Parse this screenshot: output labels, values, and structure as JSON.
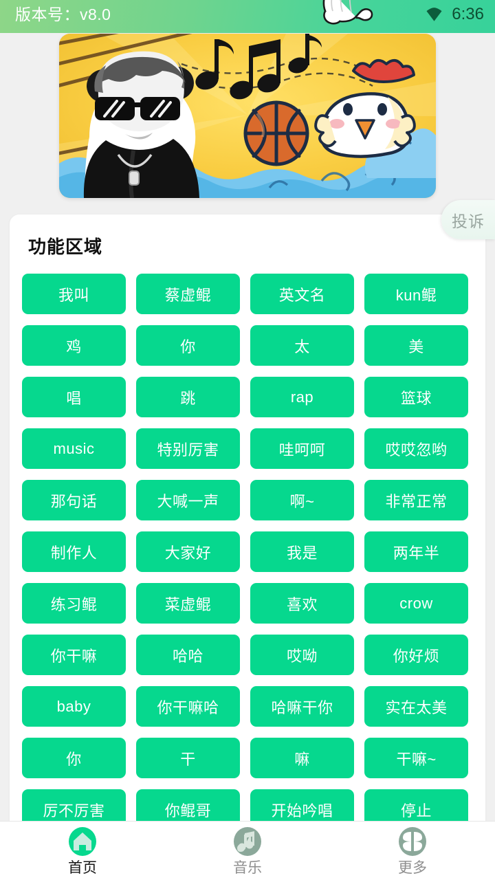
{
  "status_bar": {
    "version_label": "版本号：v8.0",
    "clock": "6:36",
    "wifi_icon": "wifi-icon",
    "glove_icon": "cartoon-glove-icon"
  },
  "banner": {
    "alt": "卡通横幅：戴墨镜的熊猫人、篮球、音符与小鸡",
    "elements": [
      "panda-man-sunglasses",
      "music-notes",
      "basketball",
      "cartoon-chicken",
      "blue-waves"
    ]
  },
  "complaint_button": {
    "label": "投诉"
  },
  "card": {
    "title": "功能区域",
    "buttons": [
      "我叫",
      "蔡虚鲲",
      "英文名",
      "kun鲲",
      "鸡",
      "你",
      "太",
      "美",
      "唱",
      "跳",
      "rap",
      "篮球",
      "music",
      "特别厉害",
      "哇呵呵",
      "哎哎忽哟",
      "那句话",
      "大喊一声",
      "啊~",
      "非常正常",
      "制作人",
      "大家好",
      "我是",
      "两年半",
      "练习鲲",
      "菜虚鲲",
      "喜欢",
      "crow",
      "你干嘛",
      "哈哈",
      "哎呦",
      "你好烦",
      "baby",
      "你干嘛哈",
      "哈嘛干你",
      "实在太美",
      "你",
      "干",
      "嘛",
      "干嘛~",
      "厉不厉害",
      "你鲲哥",
      "开始吟唱",
      "停止"
    ]
  },
  "bottom_nav": {
    "items": [
      {
        "label": "首页",
        "icon": "home-icon",
        "active": true
      },
      {
        "label": "音乐",
        "icon": "music-note-icon",
        "active": false
      },
      {
        "label": "更多",
        "icon": "grid-more-icon",
        "active": false
      }
    ]
  },
  "colors": {
    "accent_green": "#06d88e",
    "header_gradient_start": "#8ed688",
    "header_gradient_end": "#37d29a",
    "page_background": "#f0f0f0",
    "card_background": "#ffffff",
    "nav_inactive": "#8e8e8e"
  }
}
